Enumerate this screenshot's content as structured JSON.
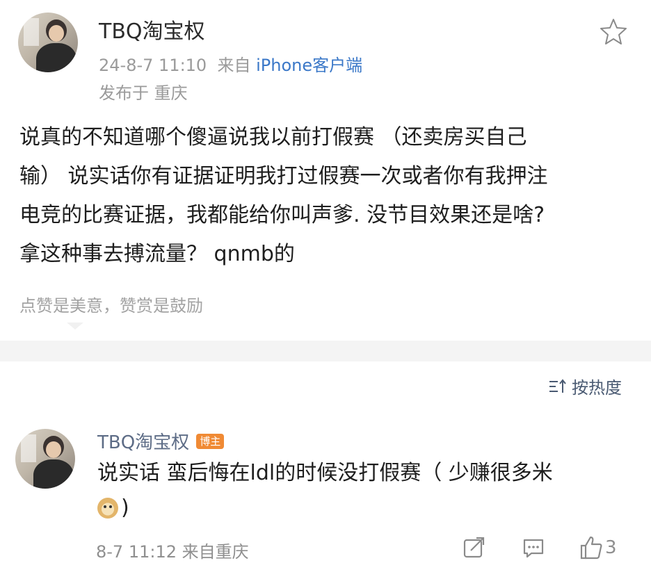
{
  "post": {
    "author": "TBQ淘宝权",
    "date": "24-8-7 11:10",
    "source_prefix": "来自",
    "source": "iPhone客户端",
    "location": "发布于 重庆",
    "text_lines": [
      "说真的不知道哪个傻逼说我以前打假赛 （还卖房买自己",
      "输） 说实话你有证据证明我打过假赛一次或者你有我押注",
      "电竞的比赛证据，我都能给你叫声爹. 没节目效果还是啥?",
      "拿这种事去搏流量？ qnmb的"
    ],
    "reward_text": "点赞是美意，赞赏是鼓励"
  },
  "sort": {
    "label": "按热度"
  },
  "comment": {
    "author": "TBQ淘宝权",
    "badge": "博主",
    "text_line1": "说实话 蛮后悔在ldl的时候没打假赛（ 少赚很多米",
    "text_line2_suffix": ")",
    "emoji_name": "doge-emoji",
    "time": "8-7 11:12",
    "location": "来自重庆",
    "like_count": "3"
  },
  "icons": [
    "star-icon",
    "sort-icon",
    "share-icon",
    "comment-icon",
    "like-icon"
  ],
  "colors": {
    "link": "#3b78c8",
    "name_blue": "#5d6c86",
    "badge": "#f08a34",
    "meta_gray": "#9a9a9a"
  }
}
